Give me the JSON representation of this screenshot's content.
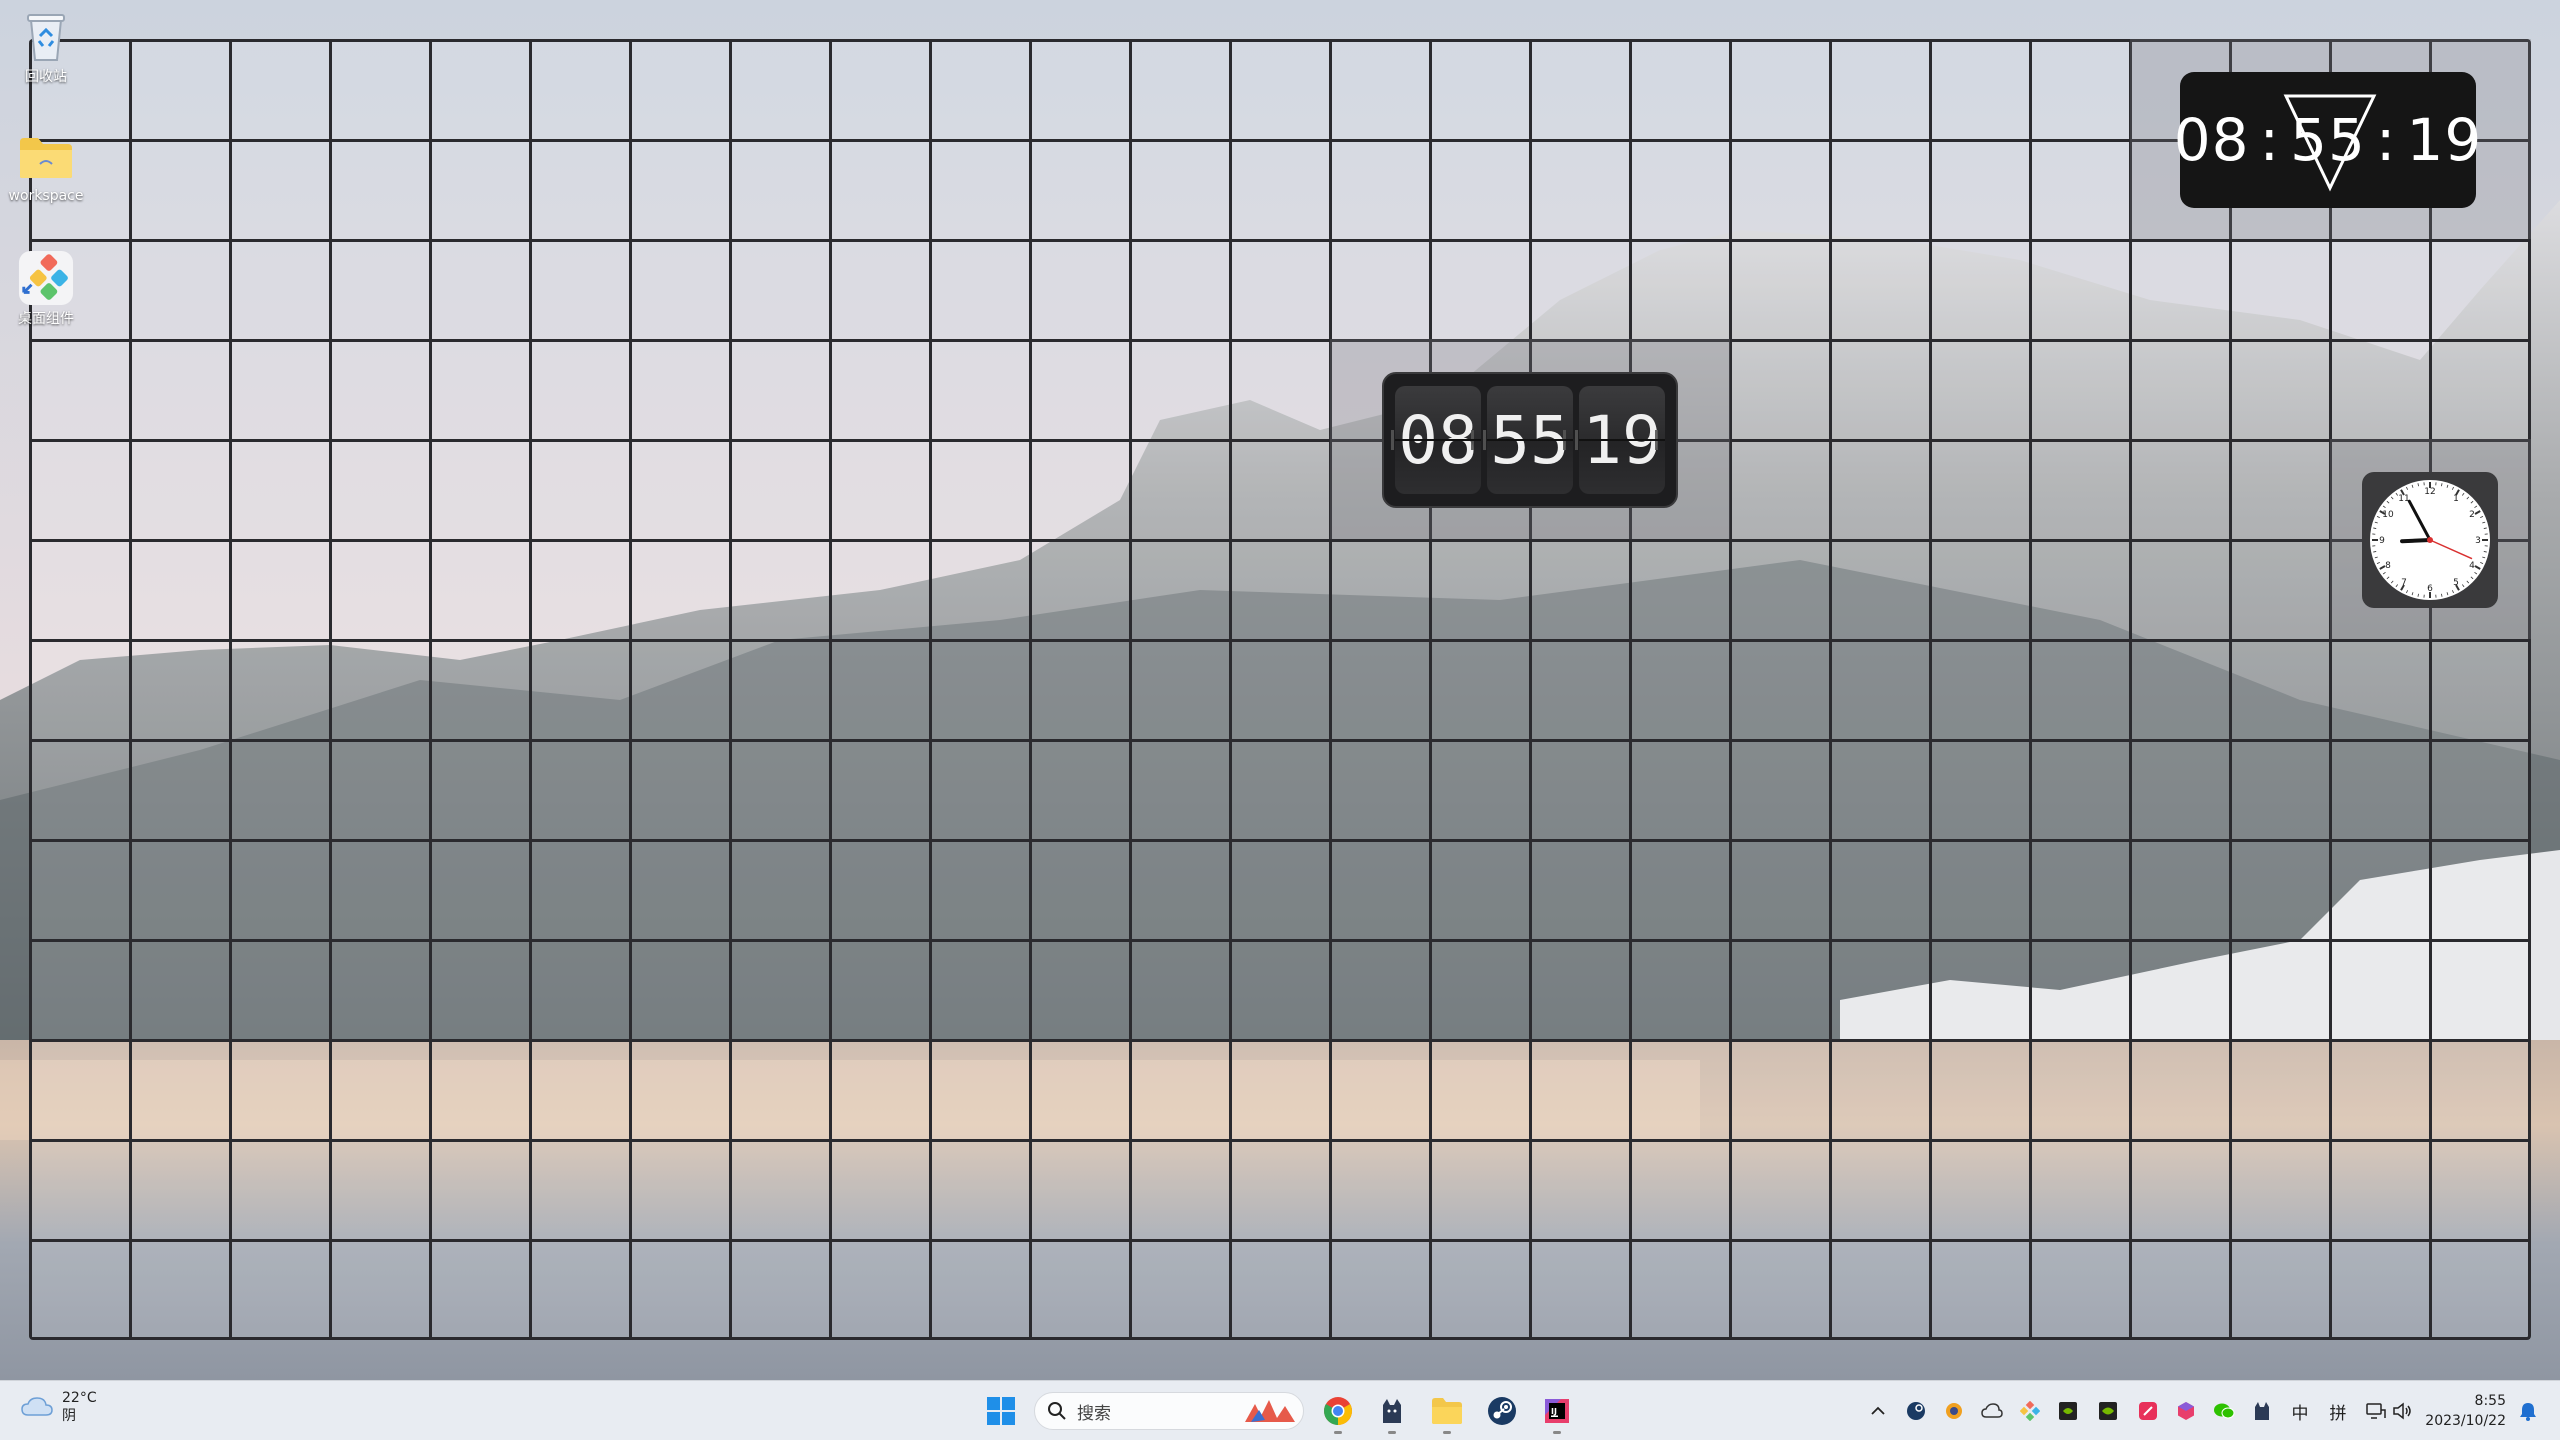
{
  "desktop": {
    "icons": [
      {
        "label": "回收站",
        "icon": "recycle-bin-icon"
      },
      {
        "label": "workspace",
        "icon": "folder-icon"
      },
      {
        "label": "桌面组件",
        "icon": "desktop-widgets-app-icon"
      }
    ]
  },
  "widgets": {
    "digital_clock": {
      "hour": "08",
      "minute": "55",
      "second": "19",
      "separator": ":"
    },
    "flip_clock": {
      "hour": "08",
      "minute": "55",
      "second": "19"
    },
    "analog_clock": {
      "hour": 8,
      "minute": 55,
      "second": 19
    }
  },
  "taskbar": {
    "weather": {
      "temperature": "22°C",
      "condition": "阴",
      "icon": "cloud-icon"
    },
    "search": {
      "placeholder": "搜索"
    },
    "pinned_apps": [
      {
        "name": "start-button",
        "icon": "windows-logo-icon"
      },
      {
        "name": "chrome",
        "icon": "chrome-icon"
      },
      {
        "name": "cat-app",
        "icon": "cat-icon"
      },
      {
        "name": "file-explorer",
        "icon": "folder-icon"
      },
      {
        "name": "steam",
        "icon": "steam-icon"
      },
      {
        "name": "jetbrains",
        "icon": "jetbrains-icon"
      }
    ],
    "tray": {
      "ime_mode": "中",
      "ime_layout": "拼",
      "time": "8:55",
      "date": "2023/10/22"
    }
  },
  "colors": {
    "taskbar_bg": "#e8ecf2",
    "widget_bg": "#151515",
    "grid_line": "#2a2a2e"
  }
}
